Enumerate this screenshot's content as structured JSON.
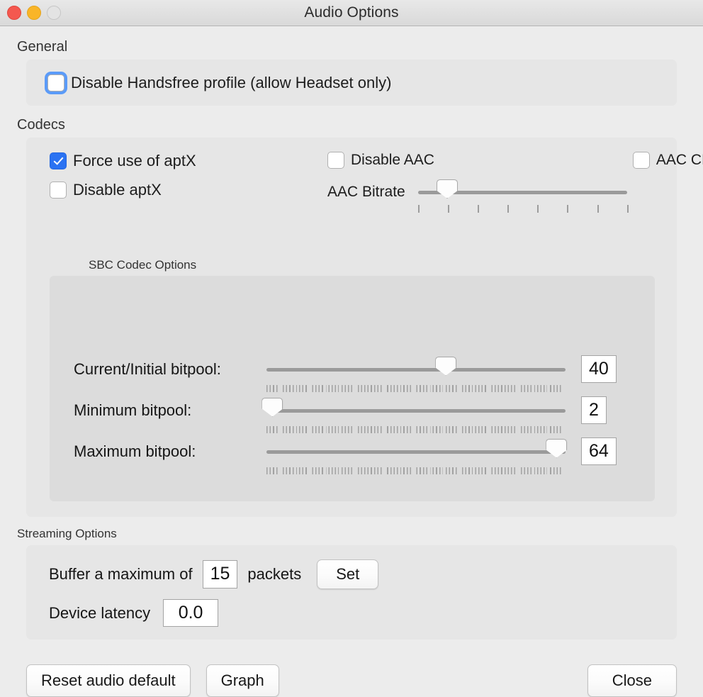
{
  "window": {
    "title": "Audio Options",
    "traffic_lights": [
      {
        "name": "close",
        "color": "#f4584f"
      },
      {
        "name": "minimize",
        "color": "#f9b528"
      },
      {
        "name": "zoom",
        "color": "#e3e3e3"
      }
    ]
  },
  "general": {
    "label": "General",
    "disable_handsfree": {
      "label": "Disable Handsfree profile (allow Headset only)",
      "checked": false,
      "focused": true
    }
  },
  "codecs": {
    "label": "Codecs",
    "force_aptx": {
      "label": "Force use of aptX",
      "checked": true
    },
    "disable_aptx": {
      "label": "Disable aptX",
      "checked": false
    },
    "disable_aac": {
      "label": "Disable AAC",
      "checked": false
    },
    "aac_cbr": {
      "label": "AAC CBR",
      "checked": false
    },
    "aac_bitrate": {
      "label": "AAC Bitrate",
      "percent": 14,
      "tick_count": 8
    },
    "sbc": {
      "label": "SBC Codec Options",
      "rows": [
        {
          "label": "Current/Initial bitpool:",
          "value": "40",
          "percent": 60
        },
        {
          "label": "Minimum bitpool:",
          "value": "2",
          "percent": 2
        },
        {
          "label": "Maximum bitpool:",
          "value": "64",
          "percent": 97
        }
      ]
    }
  },
  "streaming": {
    "label": "Streaming Options",
    "buffer_prefix": "Buffer a maximum of",
    "buffer_value": "15",
    "buffer_suffix": "packets",
    "set_button": "Set",
    "latency_label": "Device latency",
    "latency_value": "0.0"
  },
  "footer": {
    "reset_button": "Reset audio default",
    "graph_button": "Graph",
    "close_button": "Close"
  }
}
